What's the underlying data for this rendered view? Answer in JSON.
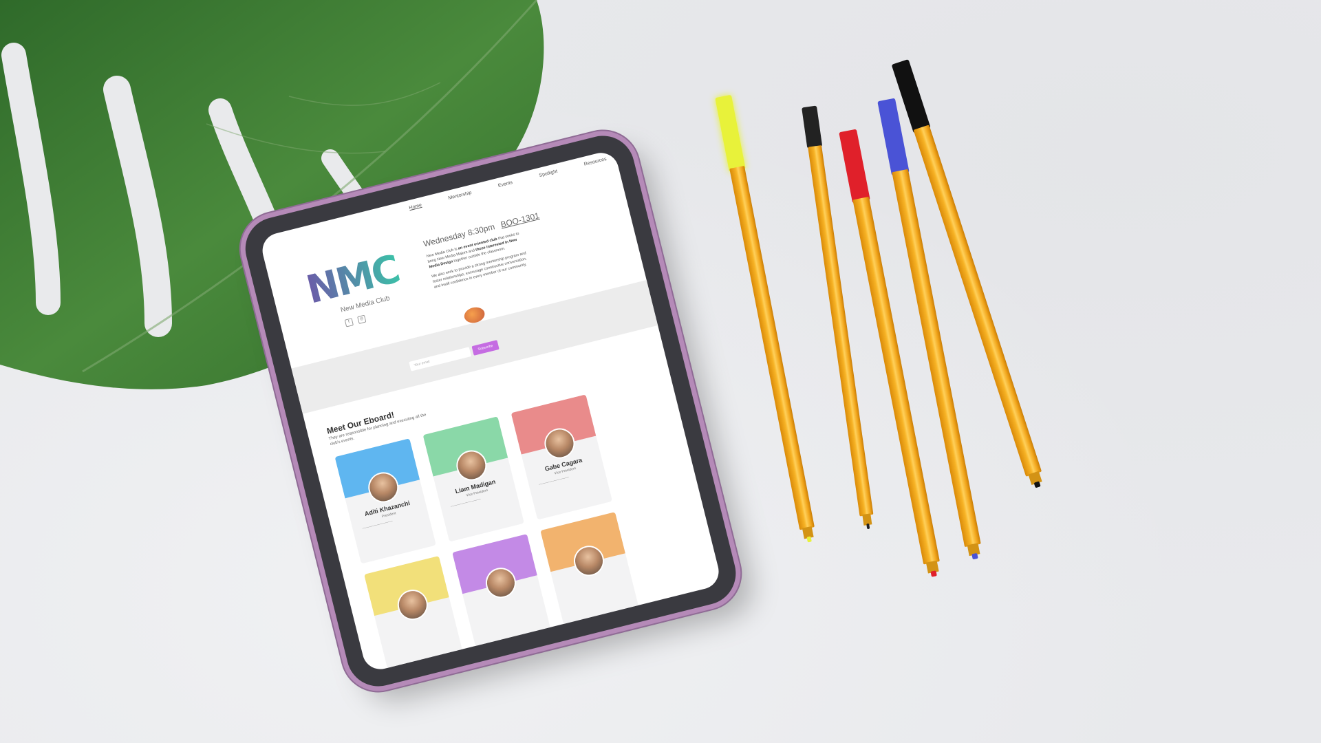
{
  "site": {
    "nav": [
      "Home",
      "Mentorship",
      "Events",
      "Spotlight",
      "Resources"
    ],
    "logo": "NMC",
    "logo_subtitle": "New Media Club",
    "meeting": {
      "day_time": "Wednesday 8:30pm",
      "room": "BOO-1301"
    },
    "about": {
      "p1_start": "New Media Club is ",
      "p1_bold1": "an event oriented club",
      "p1_mid": " that seeks to bring New Media Majors and ",
      "p1_bold2": "those interested in New Media Design",
      "p1_end": " together outside the classroom.",
      "p2": "We also seek to provide a strong mentorship program and foster relationships, encourage constructive conversation, and instill confidence in every member of our community."
    },
    "subscribe": {
      "placeholder": "Your email",
      "button": "Subscribe"
    },
    "eboard": {
      "title": "Meet Our Eboard!",
      "subtitle": "They are responsible for planning and executing all the club's events."
    },
    "members": [
      {
        "name": "Aditi Khazanchi",
        "role": "President",
        "color": "#5fb6f0"
      },
      {
        "name": "Liam Madigan",
        "role": "Vice President",
        "color": "#8ad8a8"
      },
      {
        "name": "Gabe Cagara",
        "role": "Vice President",
        "color": "#e98b8b"
      },
      {
        "name": "",
        "role": "",
        "color": "#f2e07a"
      },
      {
        "name": "",
        "role": "",
        "color": "#c38ae6"
      },
      {
        "name": "",
        "role": "",
        "color": "#f2b36e"
      }
    ]
  },
  "colors": {
    "tablet_frame": "#b58ab8",
    "leaf": "#3f7a33",
    "barrel": "#f2a61c"
  },
  "pens": [
    {
      "cap": "yellow",
      "cap_color": "#e8f23a"
    },
    {
      "cap": "black",
      "cap_color": "#222222"
    },
    {
      "cap": "red",
      "cap_color": "#e0202a"
    },
    {
      "cap": "blue",
      "cap_color": "#4a53d6"
    },
    {
      "cap": "black",
      "cap_color": "#111111"
    }
  ]
}
